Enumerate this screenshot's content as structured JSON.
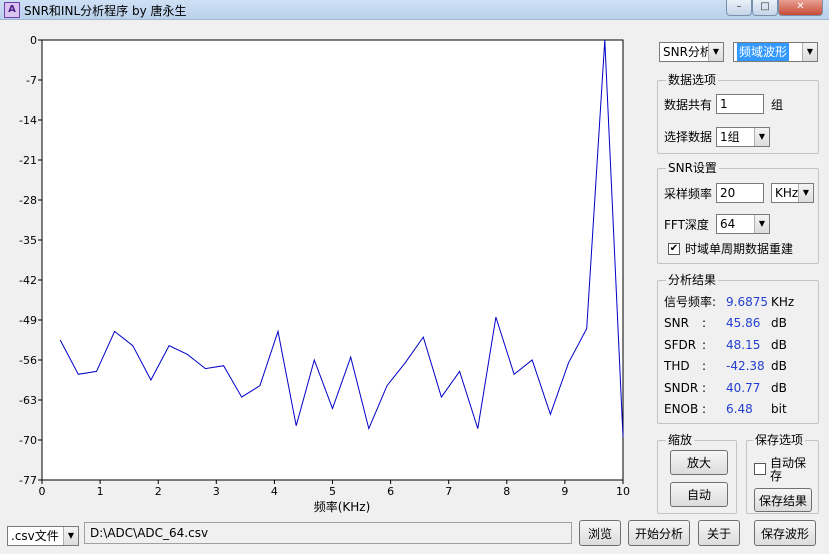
{
  "window": {
    "title": "SNR和INL分析程序 by 唐永生",
    "app_icon_glyph": "A",
    "controls": {
      "minimize": "–",
      "maximize": "□",
      "close": "✕"
    }
  },
  "top_controls": {
    "analysis_mode": "SNR分析",
    "view_mode": "频域波形"
  },
  "data_options": {
    "title": "数据选项",
    "total_label": "数据共有",
    "total_value": "1",
    "total_unit": "组",
    "select_label": "选择数据",
    "select_value": "1组"
  },
  "snr_settings": {
    "title": "SNR设置",
    "sample_rate_label": "采样频率",
    "sample_rate_value": "20",
    "sample_rate_unit": "KHz",
    "fft_label": "FFT深度",
    "fft_value": "64",
    "rebuild_label": "时域单周期数据重建",
    "rebuild_checked": true
  },
  "results": {
    "title": "分析结果",
    "rows": [
      {
        "name": "信号频率:",
        "sep": "",
        "value": "9.6875",
        "unit": "KHz"
      },
      {
        "name": "SNR",
        "sep": ":",
        "value": "45.86",
        "unit": "dB"
      },
      {
        "name": "SFDR",
        "sep": ":",
        "value": "48.15",
        "unit": "dB"
      },
      {
        "name": "THD",
        "sep": ":",
        "value": "-42.38",
        "unit": "dB"
      },
      {
        "name": "SNDR",
        "sep": ":",
        "value": "40.77",
        "unit": "dB"
      },
      {
        "name": "ENOB",
        "sep": ":",
        "value": "6.48",
        "unit": "bit"
      }
    ]
  },
  "zoom": {
    "title": "缩放",
    "zoom_in": "放大",
    "auto": "自动"
  },
  "save_options": {
    "title": "保存选项",
    "auto_save_label": "自动保存",
    "auto_save_checked": false,
    "save_result": "保存结果",
    "save_waveform": "保存波形"
  },
  "bottom_bar": {
    "file_type": ".csv文件",
    "file_path": "D:\\ADC\\ADC_64.csv",
    "browse": "浏览",
    "start": "开始分析",
    "about": "关于"
  },
  "chart_data": {
    "type": "line",
    "xlabel": "频率(KHz)",
    "ylabel": "",
    "title": "",
    "xlim": [
      0,
      10
    ],
    "ylim": [
      -77,
      0
    ],
    "x_ticks": [
      0,
      1,
      2,
      3,
      4,
      5,
      6,
      7,
      8,
      9,
      10
    ],
    "y_ticks": [
      0,
      -7,
      -14,
      -21,
      -28,
      -35,
      -42,
      -49,
      -56,
      -63,
      -70,
      -77
    ],
    "grid": false,
    "line_color": "#0000c8",
    "series": [
      {
        "x": [
          0.3125,
          0.625,
          0.9375,
          1.25,
          1.5625,
          1.875,
          2.1875,
          2.5,
          2.8125,
          3.125,
          3.4375,
          3.75,
          4.0625,
          4.375,
          4.6875,
          5.0,
          5.3125,
          5.625,
          5.9375,
          6.25,
          6.5625,
          6.875,
          7.1875,
          7.5,
          7.8125,
          8.125,
          8.4375,
          8.75,
          9.0625,
          9.375,
          9.6875,
          10.0
        ],
        "y": [
          -52.5,
          -58.5,
          -58.0,
          -51.0,
          -53.5,
          -59.5,
          -53.5,
          -55.0,
          -57.5,
          -57.0,
          -62.5,
          -60.5,
          -51.0,
          -67.5,
          -56.0,
          -64.5,
          -55.5,
          -68.0,
          -60.5,
          -56.5,
          -52.0,
          -62.5,
          -58.0,
          -68.0,
          -48.5,
          -58.5,
          -56.0,
          -65.5,
          -56.5,
          -50.5,
          0.0,
          -69.5
        ]
      }
    ]
  }
}
